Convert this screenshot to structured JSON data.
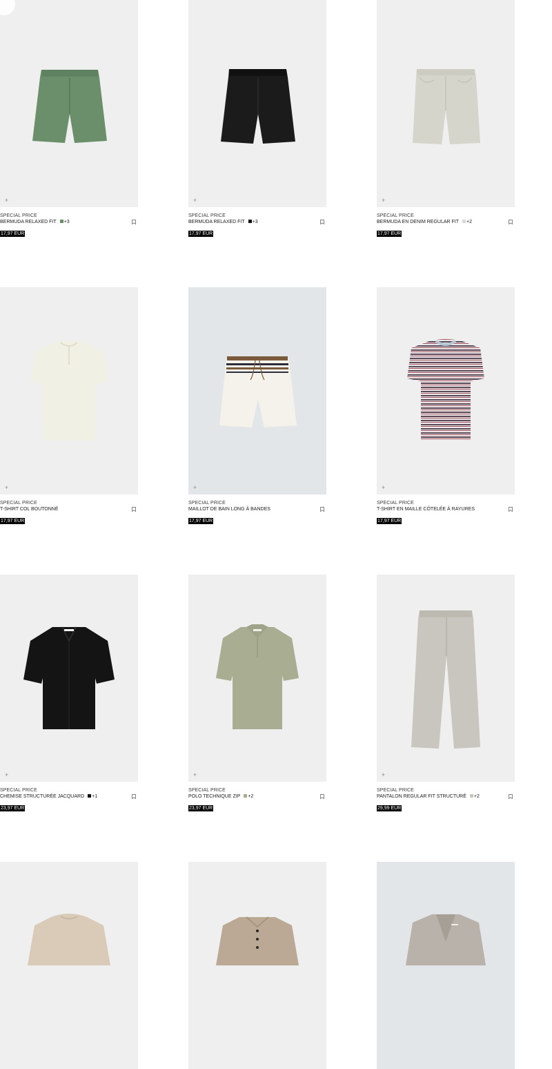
{
  "products": [
    {
      "promo": "SPECIAL PRICE",
      "name": "BERMUDA RELAXED FIT",
      "swatch": "#6b8f6b",
      "more": "+3",
      "price": "17,97 EUR",
      "image": "shorts-green"
    },
    {
      "promo": "SPECIAL PRICE",
      "name": "BERMUDA RELAXED FIT",
      "swatch": "#111111",
      "more": "+3",
      "price": "17,97 EUR",
      "image": "shorts-black"
    },
    {
      "promo": "SPECIAL PRICE",
      "name": "BERMUDA EN DENIM REGULAR FIT",
      "swatch": "#d8d8d4",
      "more": "+2",
      "price": "17,97 EUR",
      "image": "shorts-denim-ecru"
    },
    {
      "promo": "SPECIAL PRICE",
      "name": "T-SHIRT COL BOUTONNÉ",
      "swatch": "",
      "more": "",
      "price": "17,97 EUR",
      "image": "tshirt-henley-cream"
    },
    {
      "promo": "SPECIAL PRICE",
      "name": "MAILLOT DE BAIN LONG À BANDES",
      "swatch": "",
      "more": "",
      "price": "17,97 EUR",
      "image": "swim-shorts-striped"
    },
    {
      "promo": "SPECIAL PRICE",
      "name": "T-SHIRT EN MAILLE CÔTELÉE À RAYURES",
      "swatch": "",
      "more": "",
      "price": "17,97 EUR",
      "image": "tshirt-striped-knit"
    },
    {
      "promo": "SPECIAL PRICE",
      "name": "CHEMISE STRUCTURÉE JACQUARD",
      "swatch": "#111111",
      "more": "+1",
      "price": "23,97 EUR",
      "image": "shirt-black"
    },
    {
      "promo": "SPECIAL PRICE",
      "name": "POLO TECHNIQUE ZIP",
      "swatch": "#a9ad92",
      "more": "+2",
      "price": "23,97 EUR",
      "image": "polo-khaki"
    },
    {
      "promo": "SPECIAL PRICE",
      "name": "PANTALON REGULAR FIT STRUCTURÉ",
      "swatch": "#c9c6bf",
      "more": "+2",
      "price": "29,99 EUR",
      "image": "trousers-grey"
    },
    {
      "promo": "",
      "name": "",
      "swatch": "",
      "more": "",
      "price": "",
      "image": "sweater-beige"
    },
    {
      "promo": "",
      "name": "",
      "swatch": "",
      "more": "",
      "price": "",
      "image": "polo-knit-taupe"
    },
    {
      "promo": "",
      "name": "",
      "swatch": "",
      "more": "",
      "price": "",
      "image": "blazer-grey"
    }
  ]
}
